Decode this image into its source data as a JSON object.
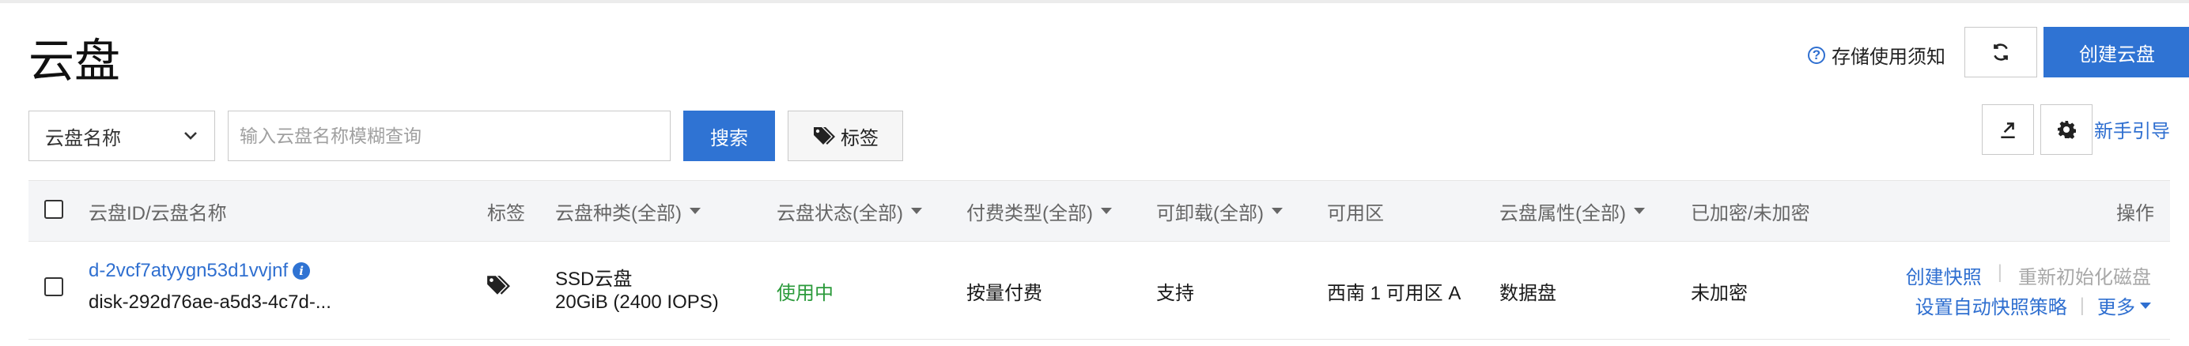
{
  "page": {
    "title": "云盘"
  },
  "header": {
    "notice_label": "存储使用须知",
    "create_label": "创建云盘"
  },
  "toolbar": {
    "filter_select": "云盘名称",
    "search_placeholder": "输入云盘名称模糊查询",
    "search_label": "搜索",
    "tag_label": "标签",
    "guide_label": "新手引导"
  },
  "table": {
    "columns": {
      "id_name": "云盘ID/云盘名称",
      "tag": "标签",
      "type": "云盘种类(全部)",
      "status": "云盘状态(全部)",
      "billing": "付费类型(全部)",
      "detachable": "可卸载(全部)",
      "zone": "可用区",
      "attribute": "云盘属性(全部)",
      "encrypted": "已加密/未加密",
      "actions": "操作"
    },
    "rows": [
      {
        "id": "d-2vcf7atyygn53d1vvjnf",
        "name": "disk-292d76ae-a5d3-4c7d-...",
        "type": "SSD云盘",
        "capacity": "20GiB (2400 IOPS)",
        "status": "使用中",
        "billing": "按量付费",
        "detachable": "支持",
        "zone": "西南 1 可用区 A",
        "attribute": "数据盘",
        "encrypted": "未加密",
        "action_snapshot": "创建快照",
        "action_reinit": "重新初始化磁盘",
        "action_policy": "设置自动快照策略",
        "action_more": "更多"
      }
    ]
  },
  "colors": {
    "primary": "#2f73d3",
    "link": "#2f6fd0",
    "status_green": "#2b9a3b"
  },
  "icons": [
    "question-icon",
    "refresh-icon",
    "tag-icon",
    "chevron-down-icon",
    "export-icon",
    "gear-icon",
    "info-icon"
  ]
}
